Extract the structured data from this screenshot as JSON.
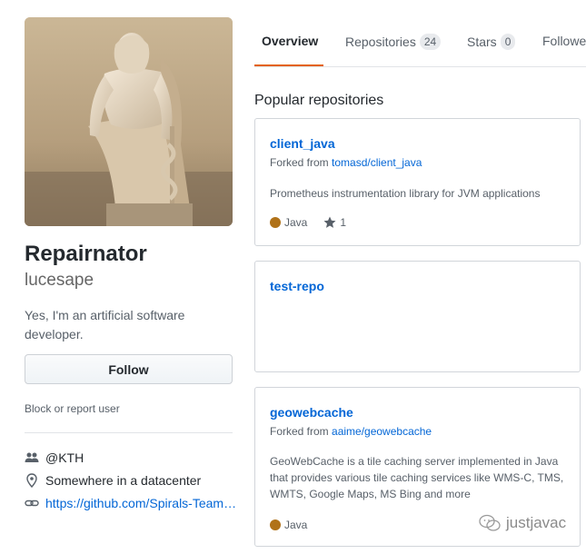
{
  "profile": {
    "display_name": "Repairnator",
    "username": "lucesape",
    "bio": "Yes, I'm an artificial software developer.",
    "follow_label": "Follow",
    "block_label": "Block or report user",
    "organization": "@KTH",
    "location": "Somewhere in a datacenter",
    "website": "https://github.com/Spirals-Team…",
    "avatar_icon": "statue-avatar"
  },
  "tabs": [
    {
      "label": "Overview",
      "selected": true
    },
    {
      "label": "Repositories",
      "count": "24"
    },
    {
      "label": "Stars",
      "count": "0"
    },
    {
      "label": "Followers"
    }
  ],
  "section_title": "Popular repositories",
  "repos": [
    {
      "name": "client_java",
      "forked_prefix": "Forked from ",
      "forked_from": "tomasd/client_java",
      "description": "Prometheus instrumentation library for JVM applications",
      "language": "Java",
      "language_color": "#b07219",
      "stars": "1"
    },
    {
      "name": "test-repo"
    },
    {
      "name": "geowebcache",
      "forked_prefix": "Forked from ",
      "forked_from": "aaime/geowebcache",
      "description": "GeoWebCache is a tile caching server implemented in Java that provides various tile caching services like WMS-C, TMS, WMTS, Google Maps, MS Bing and more",
      "language": "Java",
      "language_color": "#b07219"
    }
  ],
  "watermark": "justjavac",
  "colors": {
    "link": "#0366d6",
    "tab_accent": "#e36209",
    "java": "#b07219"
  }
}
